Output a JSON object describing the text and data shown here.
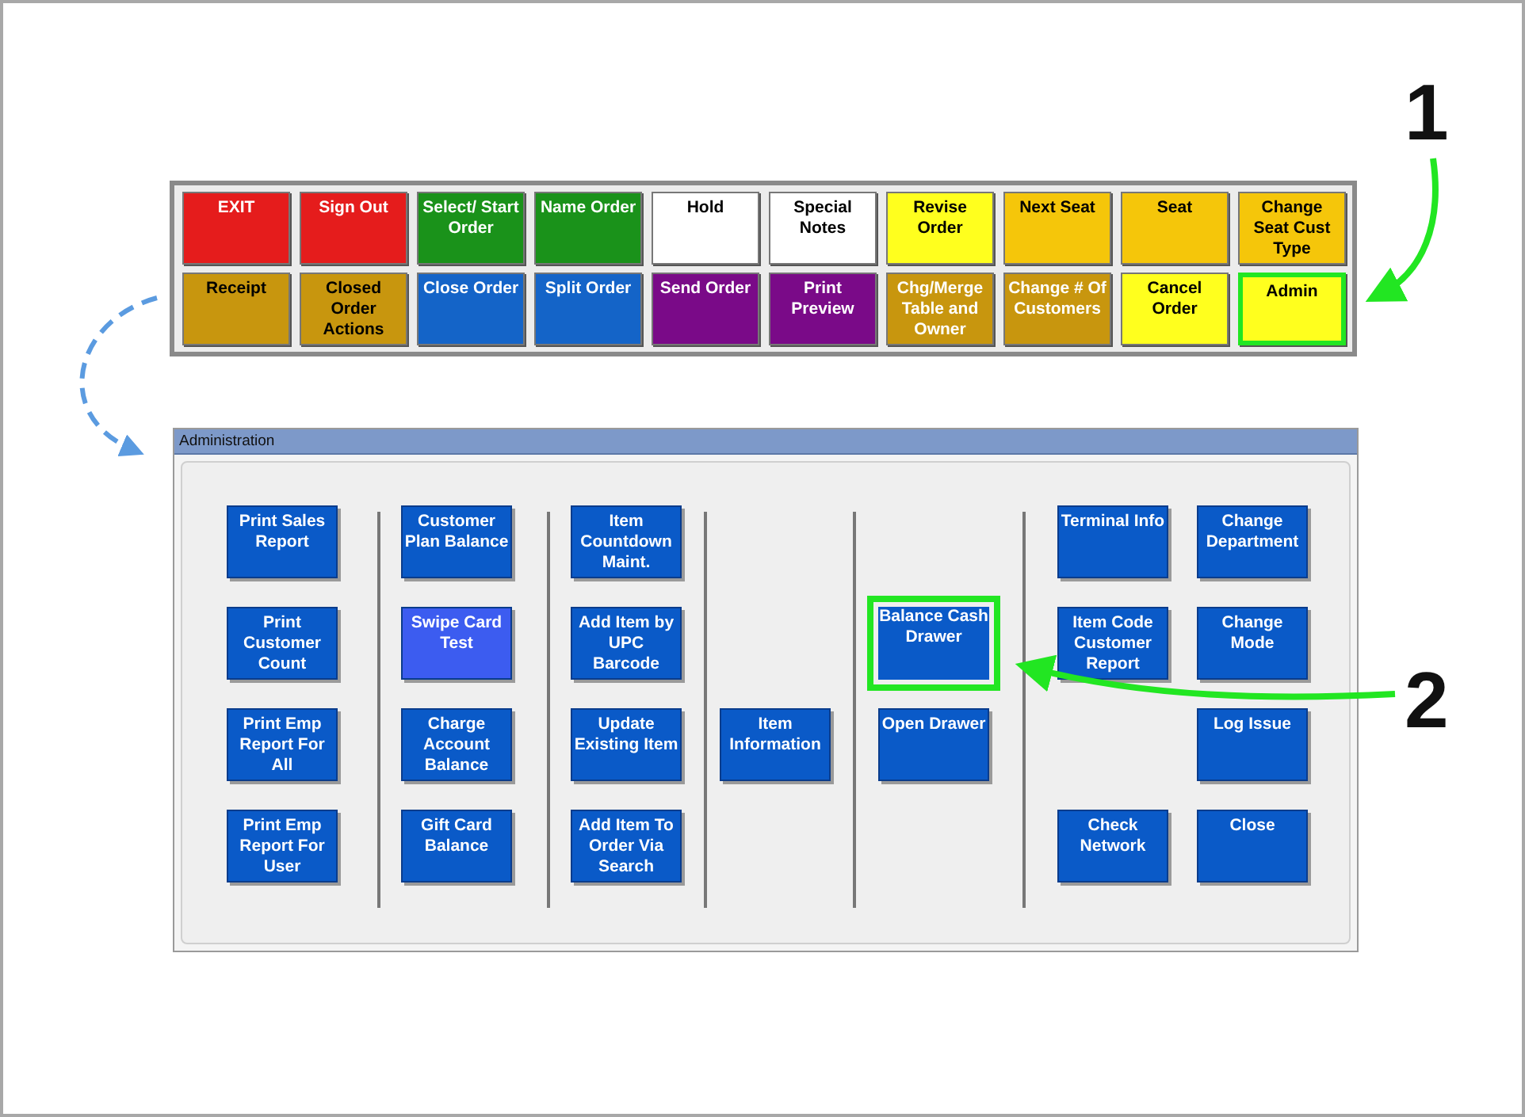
{
  "toolbar": {
    "buttons": [
      {
        "label": "EXIT",
        "color": "#e51c1c",
        "kind": "light",
        "highlighted": false
      },
      {
        "label": "Sign Out",
        "color": "#e51c1c",
        "kind": "light",
        "highlighted": false
      },
      {
        "label": "Select/ Start Order",
        "color": "#1a921a",
        "kind": "light",
        "highlighted": false
      },
      {
        "label": "Name Order",
        "color": "#1a921a",
        "kind": "light",
        "highlighted": false
      },
      {
        "label": "Hold",
        "color": "#ffffff",
        "kind": "dark",
        "highlighted": false
      },
      {
        "label": "Special Notes",
        "color": "#ffffff",
        "kind": "dark",
        "highlighted": false
      },
      {
        "label": "Revise Order",
        "color": "#ffff1e",
        "kind": "dark",
        "highlighted": false
      },
      {
        "label": "Next Seat",
        "color": "#f5c60a",
        "kind": "dark",
        "highlighted": false
      },
      {
        "label": "Seat",
        "color": "#f5c60a",
        "kind": "dark",
        "highlighted": false
      },
      {
        "label": "Change Seat Cust Type",
        "color": "#f5c60a",
        "kind": "dark",
        "highlighted": false
      },
      {
        "label": "Receipt",
        "color": "#c8960e",
        "kind": "dark",
        "highlighted": false
      },
      {
        "label": "Closed Order Actions",
        "color": "#c8960e",
        "kind": "dark",
        "highlighted": false
      },
      {
        "label": "Close Order",
        "color": "#1464c8",
        "kind": "light",
        "highlighted": false
      },
      {
        "label": "Split Order",
        "color": "#1464c8",
        "kind": "light",
        "highlighted": false
      },
      {
        "label": "Send Order",
        "color": "#7a0a88",
        "kind": "light",
        "highlighted": false
      },
      {
        "label": "Print Preview",
        "color": "#7a0a88",
        "kind": "light",
        "highlighted": false
      },
      {
        "label": "Chg/Merge Table and Owner",
        "color": "#c8960e",
        "kind": "light",
        "highlighted": false
      },
      {
        "label": "Change # Of Customers",
        "color": "#c8960e",
        "kind": "light",
        "highlighted": false
      },
      {
        "label": "Cancel Order",
        "color": "#ffff1e",
        "kind": "dark",
        "highlighted": false
      },
      {
        "label": "Admin",
        "color": "#ffff1e",
        "kind": "dark",
        "highlighted": true
      }
    ]
  },
  "admin": {
    "title": "Administration",
    "groups": [
      {
        "columns": [
          [
            {
              "label": "Print Sales Report",
              "selected": false,
              "highlighted": false
            },
            {
              "label": "Print Customer Count",
              "selected": false,
              "highlighted": false
            },
            {
              "label": "Print Emp Report For All",
              "selected": false,
              "highlighted": false
            },
            {
              "label": "Print Emp Report For User",
              "selected": false,
              "highlighted": false
            }
          ]
        ]
      },
      {
        "columns": [
          [
            {
              "label": "Customer Plan Balance",
              "selected": false,
              "highlighted": false
            },
            {
              "label": "Swipe Card Test",
              "selected": true,
              "highlighted": false
            },
            {
              "label": "Charge Account Balance",
              "selected": false,
              "highlighted": false
            },
            {
              "label": "Gift Card Balance",
              "selected": false,
              "highlighted": false
            }
          ]
        ]
      },
      {
        "columns": [
          [
            {
              "label": "Item Countdown Maint.",
              "selected": false,
              "highlighted": false
            },
            {
              "label": "Add Item by UPC Barcode",
              "selected": false,
              "highlighted": false
            },
            {
              "label": "Update Existing Item",
              "selected": false,
              "highlighted": false
            },
            {
              "label": "Add Item To Order Via Search",
              "selected": false,
              "highlighted": false
            }
          ]
        ]
      },
      {
        "columns": [
          [
            null,
            null,
            {
              "label": "Item Information",
              "selected": false,
              "highlighted": false
            },
            null
          ]
        ]
      },
      {
        "columns": [
          [
            null,
            {
              "label": "Balance Cash Drawer",
              "selected": false,
              "highlighted": true
            },
            {
              "label": "Open Drawer",
              "selected": false,
              "highlighted": false
            },
            null
          ]
        ]
      },
      {
        "columns": [
          [
            {
              "label": "Terminal Info",
              "selected": false,
              "highlighted": false
            },
            {
              "label": "Item Code Customer Report",
              "selected": false,
              "highlighted": false
            },
            null,
            {
              "label": "Check Network",
              "selected": false,
              "highlighted": false
            }
          ],
          [
            {
              "label": "Change Department",
              "selected": false,
              "highlighted": false
            },
            {
              "label": "Change Mode",
              "selected": false,
              "highlighted": false
            },
            {
              "label": "Log Issue",
              "selected": false,
              "highlighted": false
            },
            {
              "label": "Close",
              "selected": false,
              "highlighted": false
            }
          ]
        ]
      }
    ]
  },
  "callouts": [
    {
      "label": "1"
    },
    {
      "label": "2"
    }
  ]
}
